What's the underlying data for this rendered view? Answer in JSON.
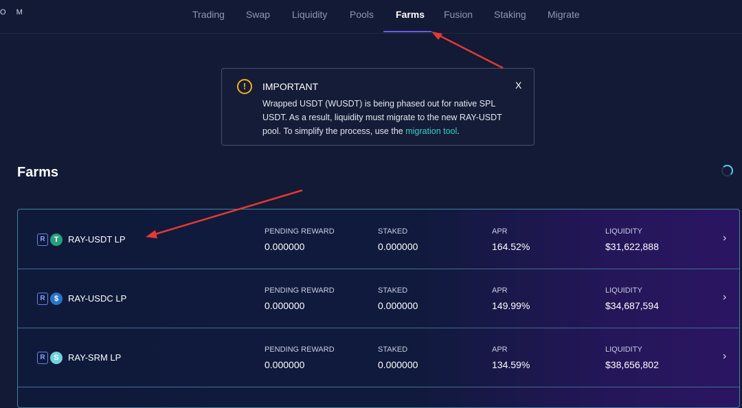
{
  "logo_text": "O M",
  "nav": {
    "items": [
      {
        "label": "Trading",
        "active": false
      },
      {
        "label": "Swap",
        "active": false
      },
      {
        "label": "Liquidity",
        "active": false
      },
      {
        "label": "Pools",
        "active": false
      },
      {
        "label": "Farms",
        "active": true
      },
      {
        "label": "Fusion",
        "active": false
      },
      {
        "label": "Staking",
        "active": false
      },
      {
        "label": "Migrate",
        "active": false
      }
    ]
  },
  "notice": {
    "title": "IMPORTANT",
    "close_label": "X",
    "body_text": "Wrapped USDT (WUSDT) is being phased out for native SPL USDT. As a result, liquidity must migrate to the new RAY-USDT pool. To simplify the process, use the",
    "link_text": "migration tool",
    "body_end": "."
  },
  "page_title": "Farms",
  "columns": {
    "pending_reward": "PENDING REWARD",
    "staked": "STAKED",
    "apr": "APR",
    "liquidity": "LIQUIDITY"
  },
  "farms": [
    {
      "name": "RAY-USDT LP",
      "pending_reward": "0.000000",
      "staked": "0.000000",
      "apr": "164.52%",
      "liquidity": "$31,622,888",
      "token_icon": "usdt-icon",
      "token_glyph": "T"
    },
    {
      "name": "RAY-USDC LP",
      "pending_reward": "0.000000",
      "staked": "0.000000",
      "apr": "149.99%",
      "liquidity": "$34,687,594",
      "token_icon": "usdc-icon",
      "token_glyph": "$"
    },
    {
      "name": "RAY-SRM LP",
      "pending_reward": "0.000000",
      "staked": "0.000000",
      "apr": "134.59%",
      "liquidity": "$38,656,802",
      "token_icon": "srm-icon",
      "token_glyph": "S"
    }
  ],
  "colors": {
    "background": "#131a35",
    "accent": "#6b5ae0",
    "link": "#39d0c4",
    "warning": "#f2b120",
    "annotation_arrow": "#e53935"
  }
}
